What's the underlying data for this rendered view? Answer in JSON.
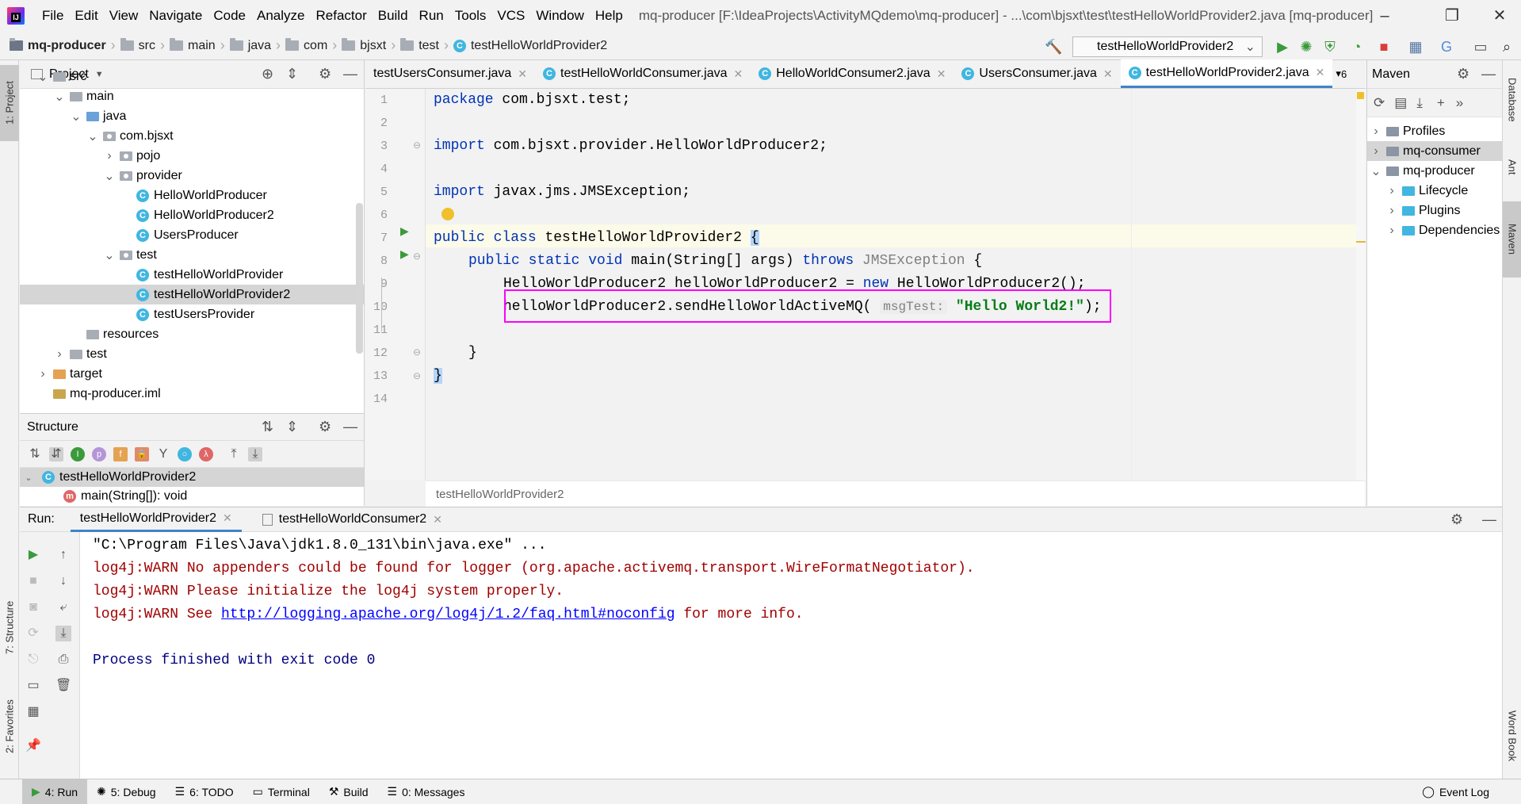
{
  "menubar": {
    "items": [
      "File",
      "Edit",
      "View",
      "Navigate",
      "Code",
      "Analyze",
      "Refactor",
      "Build",
      "Run",
      "Tools",
      "VCS",
      "Window",
      "Help"
    ],
    "title": "mq-producer [F:\\IdeaProjects\\ActivityMQdemo\\mq-producer] - ...\\com\\bjsxt\\test\\testHelloWorldProvider2.java [mq-producer]"
  },
  "nav": {
    "crumbs": [
      "mq-producer",
      "src",
      "main",
      "java",
      "com",
      "bjsxt",
      "test",
      "testHelloWorldProvider2"
    ],
    "run_config": "testHelloWorldProvider2"
  },
  "left_strip": {
    "project": "1: Project",
    "structure": "7: Structure",
    "favorites": "2: Favorites"
  },
  "right_strip": {
    "database": "Database",
    "ant": "Ant",
    "maven": "Maven",
    "wordbook": "Word Book"
  },
  "project": {
    "title": "Project",
    "tree": [
      {
        "label": "src",
        "depth": 2,
        "arrow": "down",
        "icon": "folder"
      },
      {
        "label": "main",
        "depth": 3,
        "arrow": "down",
        "icon": "folder"
      },
      {
        "label": "java",
        "depth": 4,
        "arrow": "down",
        "icon": "blue"
      },
      {
        "label": "com.bjsxt",
        "depth": 5,
        "arrow": "down",
        "icon": "pkg"
      },
      {
        "label": "pojo",
        "depth": 6,
        "arrow": "right",
        "icon": "pkg"
      },
      {
        "label": "provider",
        "depth": 6,
        "arrow": "down",
        "icon": "pkg"
      },
      {
        "label": "HelloWorldProducer",
        "depth": 7,
        "arrow": "",
        "icon": "class"
      },
      {
        "label": "HelloWorldProducer2",
        "depth": 7,
        "arrow": "",
        "icon": "class"
      },
      {
        "label": "UsersProducer",
        "depth": 7,
        "arrow": "",
        "icon": "class"
      },
      {
        "label": "test",
        "depth": 6,
        "arrow": "down",
        "icon": "pkg"
      },
      {
        "label": "testHelloWorldProvider",
        "depth": 7,
        "arrow": "",
        "icon": "class"
      },
      {
        "label": "testHelloWorldProvider2",
        "depth": 7,
        "arrow": "",
        "icon": "class",
        "selected": true
      },
      {
        "label": "testUsersProvider",
        "depth": 7,
        "arrow": "",
        "icon": "class"
      },
      {
        "label": "resources",
        "depth": 4,
        "arrow": "",
        "icon": "folder"
      },
      {
        "label": "test",
        "depth": 3,
        "arrow": "right",
        "icon": "folder"
      },
      {
        "label": "target",
        "depth": 2,
        "arrow": "right",
        "icon": "orange"
      },
      {
        "label": "mq-producer.iml",
        "depth": 2,
        "arrow": "",
        "icon": "file"
      }
    ]
  },
  "structure": {
    "title": "Structure",
    "class_name": "testHelloWorldProvider2",
    "method": "main(String[]): void"
  },
  "editor": {
    "tabs": [
      {
        "label": "testUsersConsumer.java",
        "active": false
      },
      {
        "label": "testHelloWorldConsumer.java",
        "active": false
      },
      {
        "label": "HelloWorldConsumer2.java",
        "active": false
      },
      {
        "label": "UsersConsumer.java",
        "active": false
      },
      {
        "label": "testHelloWorldProvider2.java",
        "active": true
      }
    ],
    "more_tabs": "6",
    "line_numbers": [
      "1",
      "2",
      "3",
      "4",
      "5",
      "6",
      "7",
      "8",
      "9",
      "10",
      "11",
      "12",
      "13",
      "14"
    ],
    "code": {
      "l1_kw": "package",
      "l1": " com.bjsxt.test;",
      "l3_kw": "import",
      "l3": " com.bjsxt.provider.HelloWorldProducer2;",
      "l5_kw": "import",
      "l5": " javax.jms.JMSException;",
      "l7_kw1": "public",
      "l7_kw2": "class",
      "l7": " testHelloWorldProvider2 ",
      "l7_brace": "{",
      "l8_kw1": "public",
      "l8_kw2": "static",
      "l8_kw3": "void",
      "l8": " main(String[] args) ",
      "l8_kw4": "throws",
      "l8_exc": " JMSException",
      "l8_end": " {",
      "l9a": "HelloWorldProducer2 helloWorldProducer2 = ",
      "l9_kw": "new",
      "l9b": " HelloWorldProducer2();",
      "l10a": "helloWorldProducer2.sendHelloWorldActiveMQ(",
      "l10_hint": "msgTest:",
      "l10_str": "\"Hello World2!\"",
      "l10b": ");",
      "l12": "}",
      "l13": "}"
    },
    "breadcrumb": "testHelloWorldProvider2"
  },
  "maven": {
    "title": "Maven",
    "items": [
      {
        "label": "Profiles",
        "depth": 0,
        "arrow": "right"
      },
      {
        "label": "mq-consumer",
        "depth": 0,
        "arrow": "right",
        "selected": true
      },
      {
        "label": "mq-producer",
        "depth": 0,
        "arrow": "down"
      },
      {
        "label": "Lifecycle",
        "depth": 1,
        "arrow": "right"
      },
      {
        "label": "Plugins",
        "depth": 1,
        "arrow": "right"
      },
      {
        "label": "Dependencies",
        "depth": 1,
        "arrow": "right"
      }
    ]
  },
  "run": {
    "label": "Run:",
    "tabs": [
      {
        "label": "testHelloWorldProvider2",
        "active": true
      },
      {
        "label": "testHelloWorldConsumer2",
        "active": false
      }
    ],
    "console": {
      "l1": "\"C:\\Program Files\\Java\\jdk1.8.0_131\\bin\\java.exe\" ...",
      "l2": "log4j:WARN No appenders could be found for logger (org.apache.activemq.transport.WireFormatNegotiator).",
      "l3": "log4j:WARN Please initialize the log4j system properly.",
      "l4a": "log4j:WARN See ",
      "l4_link": "http://logging.apache.org/log4j/1.2/faq.html#noconfig",
      "l4b": " for more info.",
      "l6": "Process finished with exit code 0"
    }
  },
  "bottombar": {
    "items": [
      "4: Run",
      "5: Debug",
      "6: TODO",
      "Terminal",
      "Build",
      "0: Messages"
    ],
    "event_log": "Event Log"
  },
  "colors": {
    "keyword": "#0033b3",
    "string": "#067d17",
    "warn": "#a00000",
    "highlight": "#ff00ff",
    "accent": "#4083c9"
  }
}
